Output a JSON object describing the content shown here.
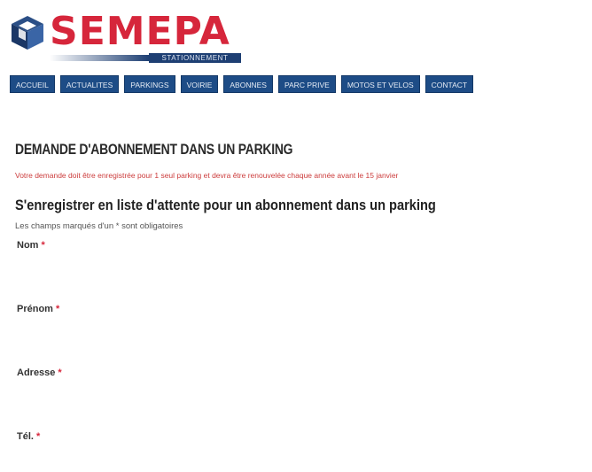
{
  "brand": {
    "name": "SEMEPA",
    "subtitle": "STATIONNEMENT",
    "color": "#d6263b",
    "navy": "#1e3f73"
  },
  "nav": {
    "items": [
      {
        "label": "ACCUEIL"
      },
      {
        "label": "ACTUALITES"
      },
      {
        "label": "PARKINGS"
      },
      {
        "label": "VOIRIE"
      },
      {
        "label": "ABONNES"
      },
      {
        "label": "PARC PRIVE"
      },
      {
        "label": "MOTOS ET VELOS"
      },
      {
        "label": "CONTACT"
      }
    ]
  },
  "main": {
    "page_title": "DEMANDE D'ABONNEMENT DANS UN PARKING",
    "notice": "Votre demande doit être enregistrée pour 1 seul parking et devra être renouvelée chaque année avant le 15 janvier",
    "form_title": "S'enregistrer en liste d'attente pour un abonnement dans un parking",
    "required_note": "Les champs marqués d'un * sont obligatoires",
    "fields": [
      {
        "label": "Nom",
        "required_mark": "*",
        "value": ""
      },
      {
        "label": "Prénom",
        "required_mark": "*",
        "value": ""
      },
      {
        "label": "Adresse",
        "required_mark": "*",
        "value": ""
      },
      {
        "label": "Tél.",
        "required_mark": "*",
        "value": ""
      }
    ]
  }
}
